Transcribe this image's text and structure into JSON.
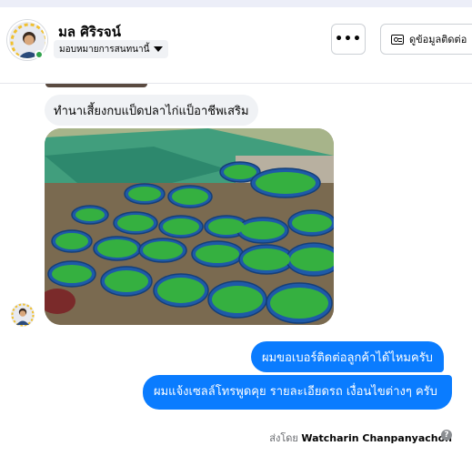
{
  "header": {
    "contact_name": "มล ศิริรจน์",
    "assign_label": "มอบหมายการสนทนานี้",
    "more_icon": "ellipsis-icon",
    "view_contact_label": "ดูข้อมูลติดต่อ",
    "view_contact_icon": "contact-card-icon"
  },
  "messages": {
    "incoming_text": "ทำนาเสี้ยงกบแป็ดปลาไก่แป็อาชีพเสริม",
    "outgoing_1": "ผมขอเบอร์ติดต่อลูกค้าได้ไหมครับ",
    "outgoing_2": "ผมแจ้งเซลล์โทรพูดคุย รายละเอียดรถ เงื่อนไขต่างๆ ครับ"
  },
  "footer": {
    "sent_by_label": "ส่งโดย",
    "sender_name": "Watcharin Chanpanyachon",
    "help_icon": "?"
  },
  "colors": {
    "outgoing_bubble": "#0a7cff",
    "incoming_bubble": "#f0f2f5",
    "online": "#31a24c"
  }
}
